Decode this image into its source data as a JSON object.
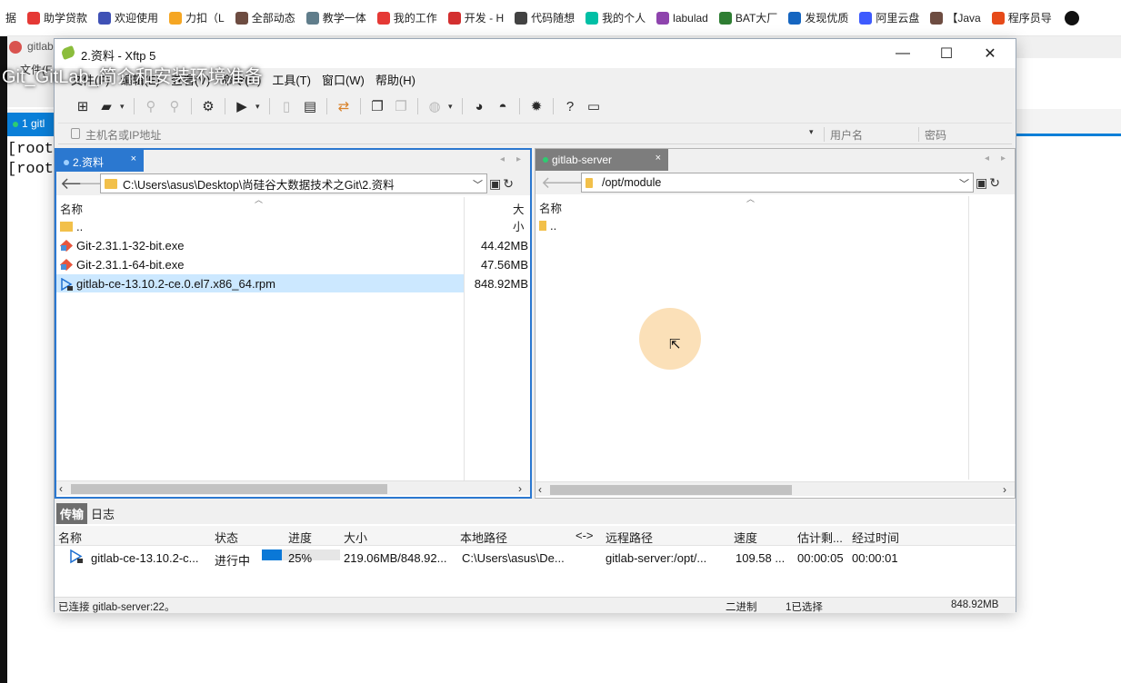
{
  "bookmarks": [
    {
      "label": "据",
      "color": "#1a73e8"
    },
    {
      "label": "助学贷款",
      "color": "#e53935"
    },
    {
      "label": "欢迎使用",
      "color": "#3f51b5"
    },
    {
      "label": "力扣（L",
      "color": "#f5a623"
    },
    {
      "label": "全部动态",
      "color": "#6d4c41"
    },
    {
      "label": "教学一体",
      "color": "#607d8b"
    },
    {
      "label": "我的工作",
      "color": "#e53935"
    },
    {
      "label": "开发 - H",
      "color": "#d32f2f"
    },
    {
      "label": "代码随想",
      "color": "#424242"
    },
    {
      "label": "我的个人",
      "color": "#00bfa5"
    },
    {
      "label": "labulad",
      "color": "#8e44ad"
    },
    {
      "label": "BAT大厂",
      "color": "#2e7d32"
    },
    {
      "label": "发现优质",
      "color": "#1565c0"
    },
    {
      "label": "阿里云盘",
      "color": "#3d5afe"
    },
    {
      "label": "【Java",
      "color": "#6d4c41"
    },
    {
      "label": "程序员导",
      "color": "#e64a19"
    }
  ],
  "terminal": {
    "title": "gitlab",
    "menu_label": "文件(F",
    "tab_label": "1 gitl",
    "lines": [
      "[root",
      "[root"
    ],
    "overlay_title": "Git_GitLab_简介和安装环境准备"
  },
  "xftp": {
    "title": "2.资料 - Xftp 5",
    "min": "—",
    "max": "☐",
    "close": "✕",
    "menu": [
      "文件(F)",
      "编辑(E)",
      "查看(V)",
      "命令(C)",
      "工具(T)",
      "窗口(W)",
      "帮助(H)"
    ],
    "host_placeholder": "主机名或IP地址",
    "user_placeholder": "用户名",
    "password_placeholder": "密码"
  },
  "left_pane": {
    "tab": "2.资料",
    "path": "C:\\Users\\asus\\Desktop\\尚硅谷大数据技术之Git\\2.资料",
    "col_name": "名称",
    "col_size": "大小",
    "files": [
      {
        "name": "..",
        "size": "",
        "type": "folder"
      },
      {
        "name": "Git-2.31.1-32-bit.exe",
        "size": "44.42MB",
        "type": "exe"
      },
      {
        "name": "Git-2.31.1-64-bit.exe",
        "size": "47.56MB",
        "type": "exe"
      },
      {
        "name": "gitlab-ce-13.10.2-ce.0.el7.x86_64.rpm",
        "size": "848.92MB",
        "type": "rpm",
        "selected": true
      }
    ]
  },
  "right_pane": {
    "tab": "gitlab-server",
    "path": "/opt/module",
    "col_name": "名称",
    "files": [
      {
        "name": "..",
        "type": "folder"
      }
    ]
  },
  "transfer": {
    "tabs": [
      "传输",
      "日志"
    ],
    "headers": [
      "名称",
      "状态",
      "进度",
      "大小",
      "本地路径",
      "<->",
      "远程路径",
      "速度",
      "估计剩...",
      "经过时间"
    ],
    "row": {
      "name": "gitlab-ce-13.10.2-c...",
      "status": "进行中",
      "progress_fraction": 0.25,
      "progress_text": "25%",
      "size": "219.06MB/848.92...",
      "local": "C:\\Users\\asus\\De...",
      "remote": "gitlab-server:/opt/...",
      "speed": "109.58 ...",
      "eta": "00:00:05",
      "elapsed": "00:00:01"
    }
  },
  "status": {
    "connection": "已连接 gitlab-server:22。",
    "mode": "二进制",
    "selection": "1已选择",
    "size": "848.92MB"
  }
}
